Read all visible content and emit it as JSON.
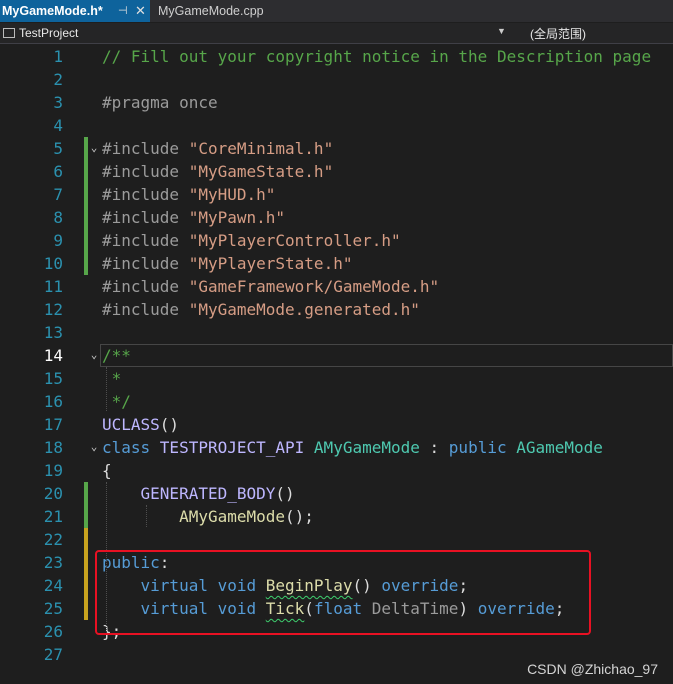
{
  "tabs": [
    {
      "label": "MyGameMode.h*",
      "active": true
    },
    {
      "label": "MyGameMode.cpp",
      "active": false
    }
  ],
  "tab_icons": {
    "pin": "pin-icon",
    "close": "close-icon"
  },
  "navbar": {
    "project": "TestProject",
    "scope": "(全局范围)"
  },
  "colors": {
    "line_number": "#2b91af",
    "comment": "#57a64a",
    "keyword": "#569cd6",
    "type": "#4ec9b0",
    "string": "#d69d85",
    "macro": "#beb7ff",
    "function": "#dcdcaa",
    "highlight_box": "#e81123",
    "change_bar_saved": "#57a64a",
    "change_bar_unsaved": "#c8a31f"
  },
  "code": [
    {
      "n": "1",
      "tokens": [
        {
          "t": "// Fill out your copyright notice in the Description page",
          "c": "cmt"
        }
      ]
    },
    {
      "n": "2",
      "tokens": []
    },
    {
      "n": "3",
      "tokens": [
        {
          "t": "#pragma once",
          "c": "pre"
        }
      ]
    },
    {
      "n": "4",
      "tokens": []
    },
    {
      "n": "5",
      "tokens": [
        {
          "t": "#include ",
          "c": "pre"
        },
        {
          "t": "\"CoreMinimal.h\"",
          "c": "str"
        }
      ]
    },
    {
      "n": "6",
      "tokens": [
        {
          "t": "#include ",
          "c": "pre"
        },
        {
          "t": "\"MyGameState.h\"",
          "c": "str"
        }
      ]
    },
    {
      "n": "7",
      "tokens": [
        {
          "t": "#include ",
          "c": "pre"
        },
        {
          "t": "\"MyHUD.h\"",
          "c": "str"
        }
      ]
    },
    {
      "n": "8",
      "tokens": [
        {
          "t": "#include ",
          "c": "pre"
        },
        {
          "t": "\"MyPawn.h\"",
          "c": "str"
        }
      ]
    },
    {
      "n": "9",
      "tokens": [
        {
          "t": "#include ",
          "c": "pre"
        },
        {
          "t": "\"MyPlayerController.h\"",
          "c": "str"
        }
      ]
    },
    {
      "n": "10",
      "tokens": [
        {
          "t": "#include ",
          "c": "pre"
        },
        {
          "t": "\"MyPlayerState.h\"",
          "c": "str"
        }
      ]
    },
    {
      "n": "11",
      "tokens": [
        {
          "t": "#include ",
          "c": "pre"
        },
        {
          "t": "\"GameFramework/GameMode.h\"",
          "c": "str"
        }
      ]
    },
    {
      "n": "12",
      "tokens": [
        {
          "t": "#include ",
          "c": "pre"
        },
        {
          "t": "\"MyGameMode.generated.h\"",
          "c": "str"
        }
      ]
    },
    {
      "n": "13",
      "tokens": []
    },
    {
      "n": "14",
      "tokens": [
        {
          "t": "/**",
          "c": "cmt"
        }
      ]
    },
    {
      "n": "15",
      "tokens": [
        {
          "t": " *",
          "c": "cmt"
        }
      ]
    },
    {
      "n": "16",
      "tokens": [
        {
          "t": " */",
          "c": "cmt"
        }
      ]
    },
    {
      "n": "17",
      "tokens": [
        {
          "t": "UCLASS",
          "c": "mac"
        },
        {
          "t": "()",
          "c": "def"
        }
      ]
    },
    {
      "n": "18",
      "tokens": [
        {
          "t": "class ",
          "c": "kw"
        },
        {
          "t": "TESTPROJECT_API ",
          "c": "mac"
        },
        {
          "t": "AMyGameMode",
          "c": "cls"
        },
        {
          "t": " : ",
          "c": "def"
        },
        {
          "t": "public ",
          "c": "kw"
        },
        {
          "t": "AGameMode",
          "c": "cls"
        }
      ]
    },
    {
      "n": "19",
      "tokens": [
        {
          "t": "{",
          "c": "def"
        }
      ]
    },
    {
      "n": "20",
      "tokens": [
        {
          "t": "    ",
          "c": "def"
        },
        {
          "t": "GENERATED_BODY",
          "c": "mac",
          "u": true
        },
        {
          "t": "()",
          "c": "def"
        }
      ]
    },
    {
      "n": "21",
      "tokens": [
        {
          "t": "        ",
          "c": "def"
        },
        {
          "t": "AMyGameMode",
          "c": "fn"
        },
        {
          "t": "();",
          "c": "def"
        }
      ]
    },
    {
      "n": "22",
      "tokens": []
    },
    {
      "n": "23",
      "tokens": [
        {
          "t": "public",
          "c": "kw"
        },
        {
          "t": ":",
          "c": "def"
        }
      ]
    },
    {
      "n": "24",
      "tokens": [
        {
          "t": "    ",
          "c": "def"
        },
        {
          "t": "virtual ",
          "c": "kw"
        },
        {
          "t": "void ",
          "c": "kw"
        },
        {
          "t": "BeginPlay",
          "c": "fn",
          "sq": true
        },
        {
          "t": "() ",
          "c": "def"
        },
        {
          "t": "override",
          "c": "kw"
        },
        {
          "t": ";",
          "c": "def"
        }
      ]
    },
    {
      "n": "25",
      "tokens": [
        {
          "t": "    ",
          "c": "def"
        },
        {
          "t": "virtual ",
          "c": "kw"
        },
        {
          "t": "void ",
          "c": "kw"
        },
        {
          "t": "Tick",
          "c": "fn",
          "sq": true
        },
        {
          "t": "(",
          "c": "def"
        },
        {
          "t": "float ",
          "c": "kw"
        },
        {
          "t": "DeltaTime",
          "c": "pre"
        },
        {
          "t": ") ",
          "c": "def"
        },
        {
          "t": "override",
          "c": "kw"
        },
        {
          "t": ";",
          "c": "def"
        }
      ]
    },
    {
      "n": "26",
      "tokens": [
        {
          "t": "};",
          "c": "def"
        }
      ]
    },
    {
      "n": "27",
      "tokens": []
    }
  ],
  "current_line": "14",
  "watermark": "CSDN @Zhichao_97"
}
